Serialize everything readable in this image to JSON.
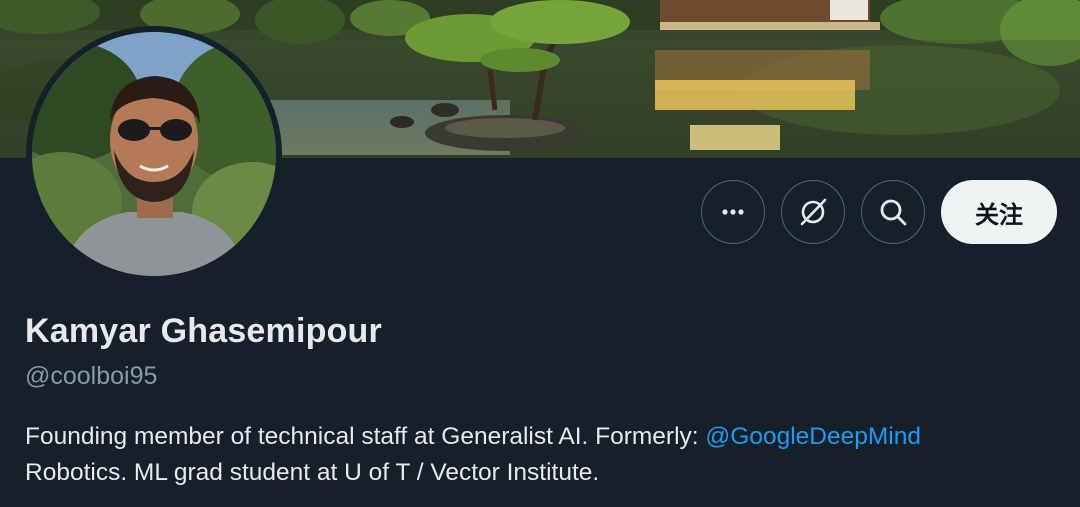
{
  "profile": {
    "name": "Kamyar Ghasemipour",
    "handle": "@coolboi95",
    "bio": {
      "line1_text": "Founding member of technical staff at Generalist AI. Formerly: ",
      "mention": "@GoogleDeepMind",
      "line2_text": "Robotics. ML grad student at U of T / Vector Institute."
    }
  },
  "actions": {
    "more_icon": "more-horizontal-icon",
    "grok_icon": "grok-icon",
    "search_icon": "search-icon",
    "follow_label": "关注"
  },
  "colors": {
    "background": "#15202b",
    "text_primary": "#e7e9ea",
    "text_secondary": "#8b98a5",
    "accent": "#1d9bf0",
    "button_light": "#eff3f4",
    "button_border": "#536471"
  }
}
